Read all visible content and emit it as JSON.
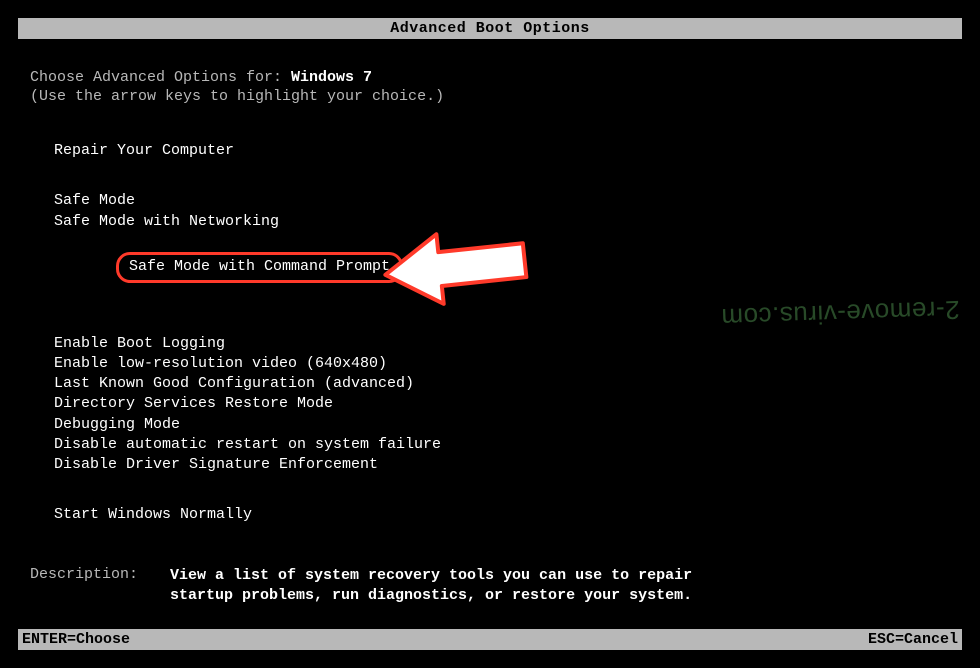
{
  "title": "Advanced Boot Options",
  "prompt_prefix": "Choose Advanced Options for: ",
  "os_name": "Windows 7",
  "hint": "(Use the arrow keys to highlight your choice.)",
  "groups": {
    "top": {
      "items": [
        "Repair Your Computer"
      ]
    },
    "safe": {
      "items": [
        "Safe Mode",
        "Safe Mode with Networking",
        "Safe Mode with Command Prompt"
      ],
      "highlighted": "Safe Mode with Command Prompt"
    },
    "advanced": {
      "items": [
        "Enable Boot Logging",
        "Enable low-resolution video (640x480)",
        "Last Known Good Configuration (advanced)",
        "Directory Services Restore Mode",
        "Debugging Mode",
        "Disable automatic restart on system failure",
        "Disable Driver Signature Enforcement"
      ]
    },
    "normal": {
      "items": [
        "Start Windows Normally"
      ]
    }
  },
  "description": {
    "label": "Description:",
    "text": "View a list of system recovery tools you can use to repair startup problems, run diagnostics, or restore your system."
  },
  "footer": {
    "left": "ENTER=Choose",
    "right": "ESC=Cancel"
  },
  "watermark": "2-remove-virus.com",
  "colors": {
    "highlight_border": "#ff3a2a"
  }
}
